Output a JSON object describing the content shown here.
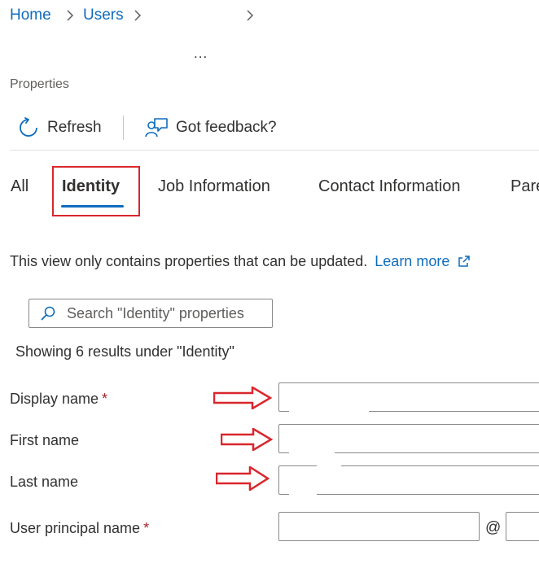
{
  "breadcrumb": {
    "items": [
      "Home",
      "Users"
    ],
    "separator": ">"
  },
  "header": {
    "more_label": "..."
  },
  "page": {
    "section_label": "Properties"
  },
  "toolbar": {
    "refresh_label": "Refresh",
    "refresh_icon": "refresh-icon",
    "feedback_label": "Got feedback?",
    "feedback_icon": "feedback-icon"
  },
  "tabs": [
    {
      "label": "All",
      "active": false
    },
    {
      "label": "Identity",
      "active": true
    },
    {
      "label": "Job Information",
      "active": false
    },
    {
      "label": "Contact Information",
      "active": false
    },
    {
      "label": "Pare",
      "active": false
    }
  ],
  "info": {
    "text": "This view only contains properties that can be updated.",
    "link_label": "Learn more",
    "link_icon": "open-external-icon"
  },
  "search": {
    "placeholder": "Search \"Identity\" properties",
    "value": ""
  },
  "results": {
    "summary": "Showing 6 results under \"Identity\""
  },
  "form": {
    "fields": [
      {
        "label": "Display name",
        "required": true,
        "value": ""
      },
      {
        "label": "First name",
        "required": false,
        "value": ""
      },
      {
        "label": "Last name",
        "required": false,
        "value": ""
      },
      {
        "label": "User principal name",
        "required": true,
        "value": "",
        "domain": ""
      }
    ],
    "required_marker": "*",
    "at_symbol": "@"
  },
  "annotations": {
    "highlight_color": "#d9262c",
    "arrow_color": "#d9262c"
  },
  "colors": {
    "link": "#0f6cbd",
    "text": "#323130",
    "required": "#a4262c"
  }
}
